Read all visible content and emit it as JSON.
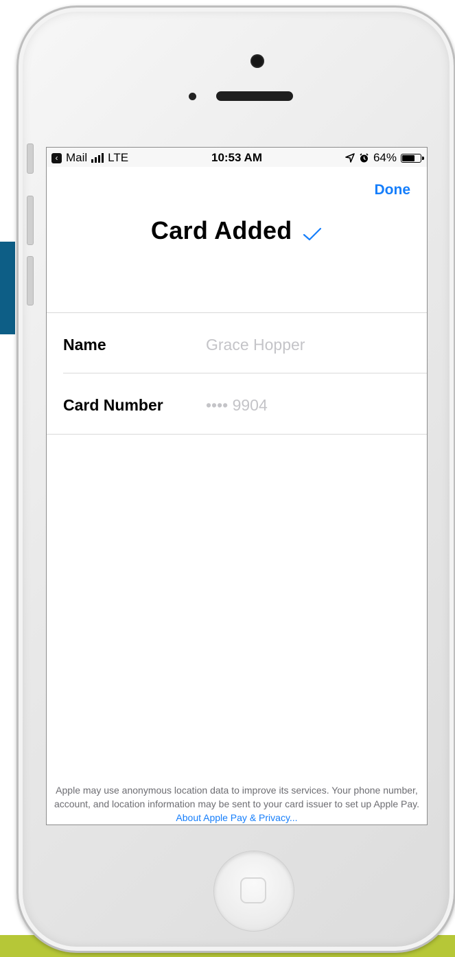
{
  "status_bar": {
    "back_app": "Mail",
    "network": "LTE",
    "time": "10:53 AM",
    "battery": "64%",
    "battery_level": 0.64,
    "signal_bars": 4
  },
  "nav": {
    "done_label": "Done"
  },
  "header": {
    "title": "Card Added",
    "check_icon": "checkmark-icon"
  },
  "fields": [
    {
      "label": "Name",
      "value": "Grace Hopper"
    },
    {
      "label": "Card Number",
      "value": "•••• 9904"
    }
  ],
  "footer": {
    "text": "Apple may use anonymous location data to improve its services. Your phone number, account, and location information may be sent to your card issuer to set up Apple Pay.",
    "link": "About Apple Pay & Privacy..."
  },
  "colors": {
    "accent": "#157efb",
    "placeholder": "#c4c4c8",
    "footer_text": "#6d6d72"
  }
}
